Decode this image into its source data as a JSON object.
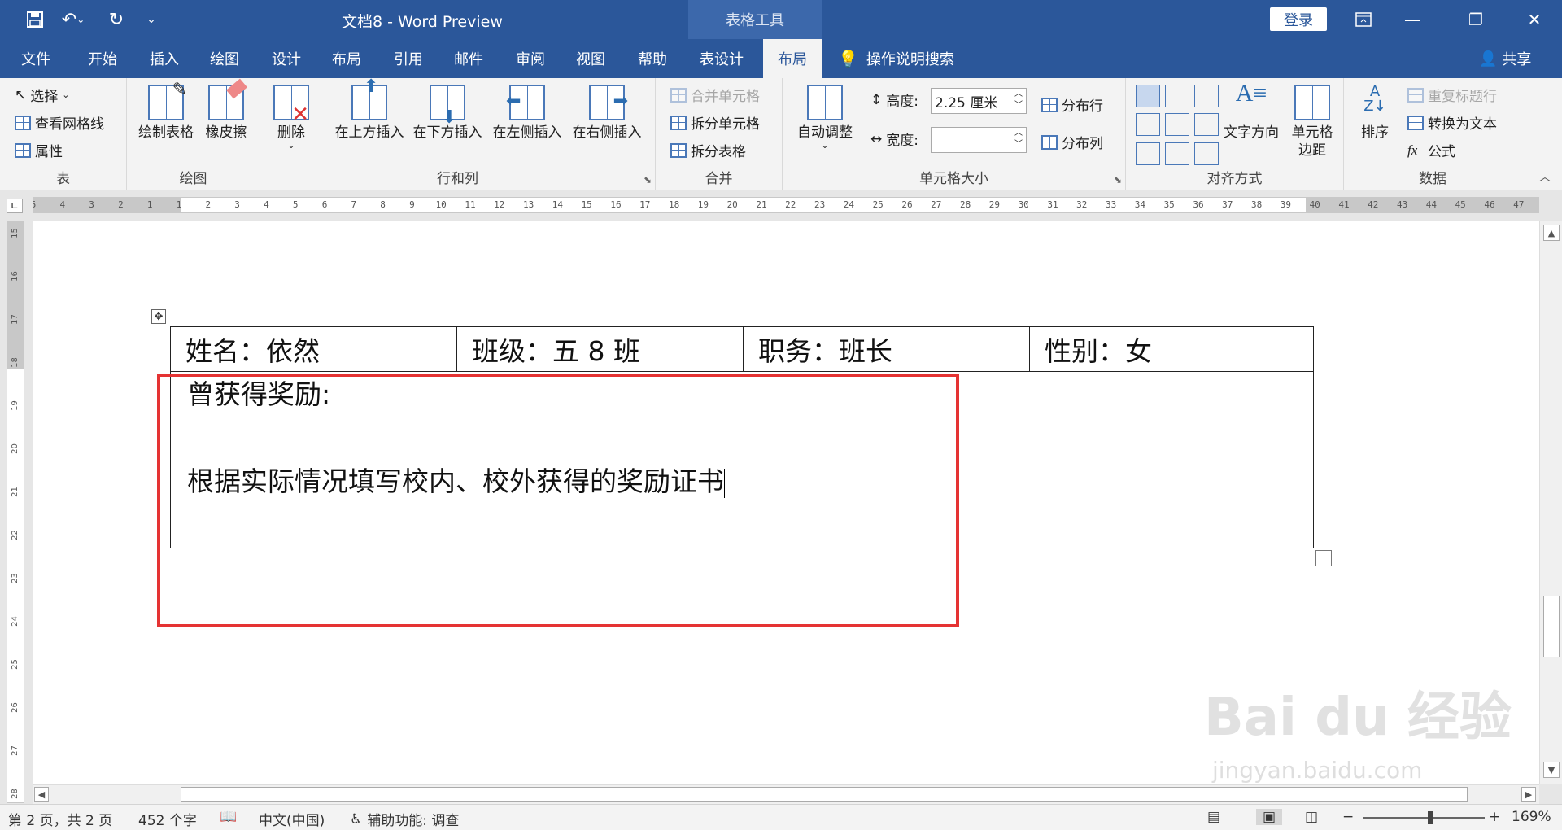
{
  "titlebar": {
    "doc_title": "文档8  -  Word Preview",
    "context_tab": "表格工具",
    "login": "登录"
  },
  "menu": {
    "tabs": [
      "文件",
      "开始",
      "插入",
      "绘图",
      "设计",
      "布局",
      "引用",
      "邮件",
      "审阅",
      "视图",
      "帮助",
      "表设计",
      "布局"
    ],
    "active_index": 12,
    "tell_me": "操作说明搜索",
    "share": "共享"
  },
  "ribbon": {
    "table": {
      "select": "选择",
      "gridlines": "查看网格线",
      "properties": "属性",
      "label": "表"
    },
    "draw": {
      "draw_table": "绘制表格",
      "eraser": "橡皮擦",
      "label": "绘图"
    },
    "rows_cols": {
      "delete": "删除",
      "insert_above": "在上方插入",
      "insert_below": "在下方插入",
      "insert_left": "在左侧插入",
      "insert_right": "在右侧插入",
      "label": "行和列"
    },
    "merge": {
      "merge_cells": "合并单元格",
      "split_cells": "拆分单元格",
      "split_table": "拆分表格",
      "label": "合并"
    },
    "cell_size": {
      "autofit": "自动调整",
      "height_label": "高度:",
      "height_value": "2.25 厘米",
      "width_label": "宽度:",
      "width_value": "",
      "dist_rows": "分布行",
      "dist_cols": "分布列",
      "label": "单元格大小"
    },
    "alignment": {
      "text_direction": "文字方向",
      "cell_margins": "单元格\n边距",
      "label": "对齐方式"
    },
    "data": {
      "sort": "排序",
      "repeat_header": "重复标题行",
      "convert_text": "转换为文本",
      "formula": "公式",
      "label": "数据"
    }
  },
  "ruler": {
    "h_numbers": [
      "5",
      "4",
      "3",
      "2",
      "1",
      "1",
      "2",
      "3",
      "4",
      "5",
      "6",
      "7",
      "8",
      "9",
      "10",
      "11",
      "12",
      "13",
      "14",
      "15",
      "16",
      "17",
      "18",
      "19",
      "20",
      "21",
      "22",
      "23",
      "24",
      "25",
      "26",
      "27",
      "28",
      "29",
      "30",
      "31",
      "32",
      "33",
      "34",
      "35",
      "36",
      "37",
      "38",
      "39",
      "40",
      "41",
      "42",
      "43",
      "44",
      "45",
      "46",
      "47"
    ],
    "v_numbers": [
      "15",
      "16",
      "17",
      "18",
      "19",
      "20",
      "21",
      "22",
      "23",
      "24",
      "25",
      "26",
      "27",
      "28"
    ]
  },
  "document": {
    "row1": [
      "姓名：依然",
      "班级：五 8 班",
      "职务：班长",
      "性别：女"
    ],
    "row2_line1": "曾获得奖励:",
    "row2_line2": "根据实际情况填写校内、校外获得的奖励证书"
  },
  "status": {
    "page": "第 2 页，共 2 页",
    "words": "452 个字",
    "language": "中文(中国)",
    "accessibility": "辅助功能: 调查",
    "zoom": "169%"
  },
  "watermark": {
    "main": "Bai du 经验",
    "url": "jingyan.baidu.com"
  }
}
